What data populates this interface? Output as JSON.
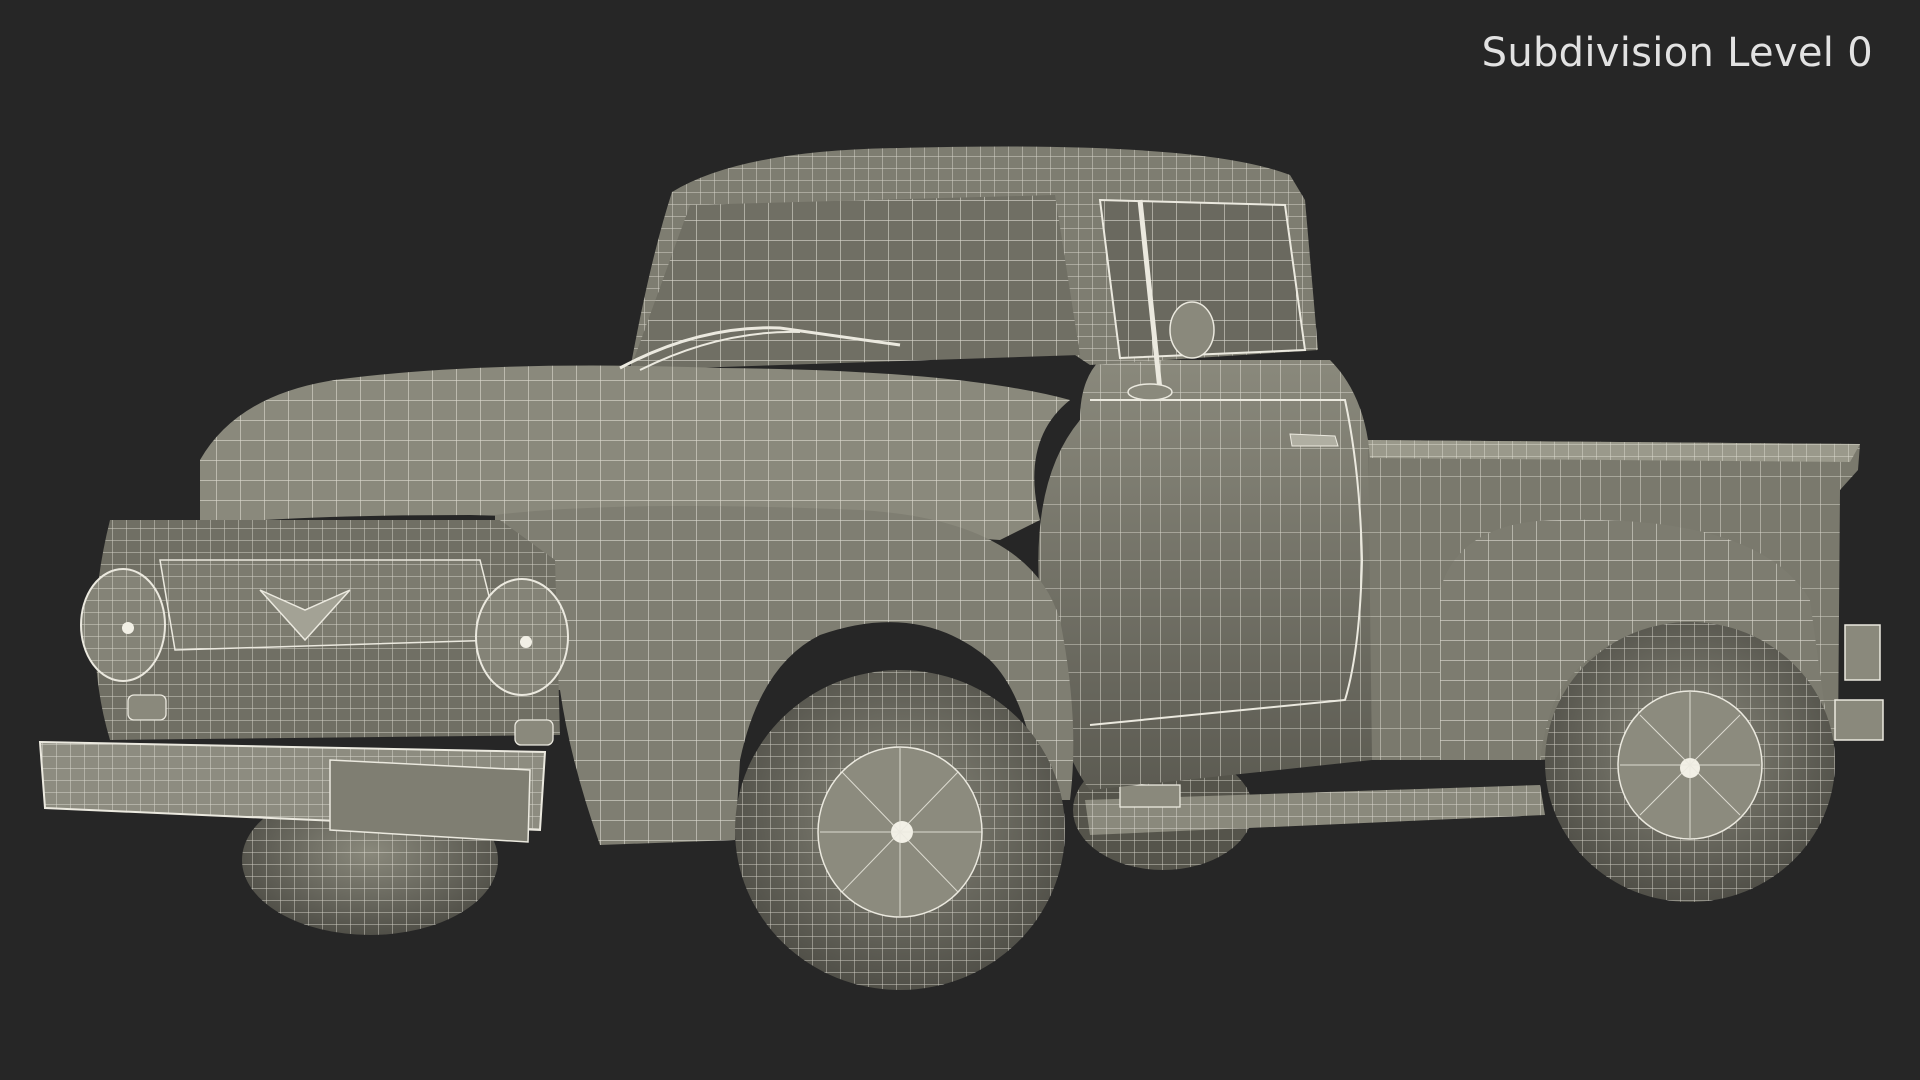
{
  "overlay": {
    "subdivision_label": "Subdivision Level 0"
  },
  "render": {
    "subject": "pickup-truck wireframe",
    "colors": {
      "background": "#262626",
      "surface_light": "#8a897c",
      "surface": "#6f6e63",
      "surface_dark": "#4b4a43",
      "wire": "#ebe9df",
      "label": "#e2e2e2"
    }
  }
}
